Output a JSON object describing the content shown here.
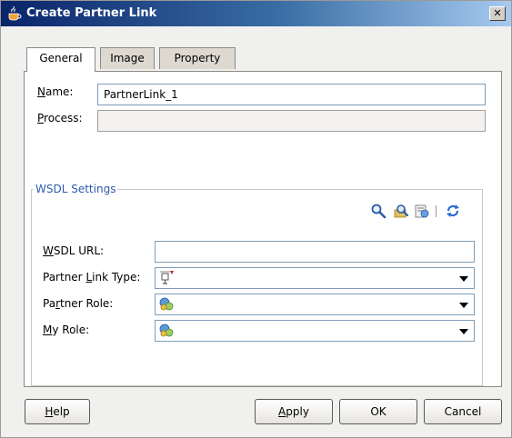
{
  "window": {
    "title": "Create Partner Link",
    "close_symbol": "✕"
  },
  "tabs": [
    {
      "label": "General",
      "active": true
    },
    {
      "label": "Image",
      "active": false
    },
    {
      "label": "Property",
      "active": false
    }
  ],
  "general": {
    "name": {
      "label_mnemonic": "N",
      "label_rest": "ame:",
      "value": "PartnerLink_1"
    },
    "process": {
      "label_mnemonic": "P",
      "label_rest": "rocess:",
      "value": ""
    }
  },
  "wsdl": {
    "legend": "WSDL Settings",
    "toolbar_icons": [
      "search-icon",
      "browse-icon",
      "service-explorer-icon",
      "refresh-icon"
    ],
    "url": {
      "label_mnemonic": "W",
      "label_rest": "SDL URL:",
      "value": ""
    },
    "partner_link_type": {
      "label_before": "Partner ",
      "label_mnemonic": "L",
      "label_rest": "ink Type:",
      "value": ""
    },
    "partner_role": {
      "label_before": "Pa",
      "label_mnemonic": "r",
      "label_rest": "tner Role:",
      "value": ""
    },
    "my_role": {
      "label_mnemonic": "M",
      "label_rest": "y Role:",
      "value": ""
    }
  },
  "buttons": {
    "help": {
      "mnemonic": "H",
      "rest": "elp"
    },
    "apply": {
      "mnemonic": "A",
      "rest": "pply"
    },
    "ok": "OK",
    "cancel": "Cancel"
  },
  "colors": {
    "title_gradient_start": "#0a246a",
    "legend_text": "#2b5ba8",
    "field_border": "#7f9db9"
  }
}
